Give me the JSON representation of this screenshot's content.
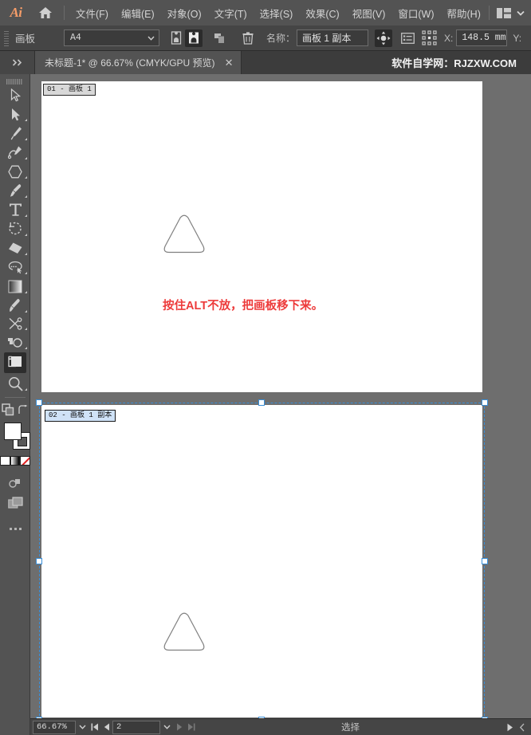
{
  "app": {
    "logo_text": "Ai",
    "home_icon": "home-icon",
    "workspace_icon": "workspace-layout-icon",
    "workspace_chevron": "chevron-down-icon"
  },
  "menubar": {
    "items": [
      {
        "label": "文件(F)",
        "name": "menu-file"
      },
      {
        "label": "编辑(E)",
        "name": "menu-edit"
      },
      {
        "label": "对象(O)",
        "name": "menu-object"
      },
      {
        "label": "文字(T)",
        "name": "menu-type"
      },
      {
        "label": "选择(S)",
        "name": "menu-select"
      },
      {
        "label": "效果(C)",
        "name": "menu-effect"
      },
      {
        "label": "视图(V)",
        "name": "menu-view"
      },
      {
        "label": "窗口(W)",
        "name": "menu-window"
      },
      {
        "label": "帮助(H)",
        "name": "menu-help"
      }
    ]
  },
  "controlbar": {
    "tool_label": "画板",
    "preset_value": "A4",
    "orientation_portrait_icon": "portrait-orientation-icon",
    "orientation_landscape_icon": "landscape-orientation-icon",
    "new_artboard_icon": "new-artboard-icon",
    "delete_icon": "trash-icon",
    "name_label": "名称：",
    "name_value": "画板 1 副本",
    "move_copy_icon": "move-copy-artboard-icon",
    "options_icon": "artboard-options-icon",
    "reference_point_icon": "reference-point-icon",
    "x_label": "X:",
    "x_value": "148.5 mm",
    "y_label": "Y:"
  },
  "tabbar": {
    "expand_icon": "double-chevron-right-icon",
    "doc_title": "未标题-1* @ 66.67% (CMYK/GPU 预览)",
    "close_icon": "close-icon",
    "watermark": "软件自学网：RJZXW.COM"
  },
  "toolbar": {
    "tools": [
      {
        "name": "selection-tool",
        "icon": "arrow-cursor-icon",
        "has_flyout": false,
        "selected": false
      },
      {
        "name": "direct-selection-tool",
        "icon": "solid-arrow-cursor-icon",
        "has_flyout": true,
        "selected": false
      },
      {
        "name": "pen-tool",
        "icon": "pen-nib-icon",
        "has_flyout": true,
        "selected": false
      },
      {
        "name": "curvature-tool",
        "icon": "curvature-pen-icon",
        "has_flyout": true,
        "selected": false
      },
      {
        "name": "shape-tool",
        "icon": "polygon-icon",
        "has_flyout": true,
        "selected": false
      },
      {
        "name": "paintbrush-tool",
        "icon": "paintbrush-icon",
        "has_flyout": true,
        "selected": false
      },
      {
        "name": "type-tool",
        "icon": "type-t-icon",
        "has_flyout": true,
        "selected": false
      },
      {
        "name": "rotate-tool",
        "icon": "rotate-arrow-icon",
        "has_flyout": true,
        "selected": false
      },
      {
        "name": "eraser-tool",
        "icon": "eraser-icon",
        "has_flyout": true,
        "selected": false
      },
      {
        "name": "lasso-tool",
        "icon": "lasso-icon",
        "has_flyout": true,
        "selected": false
      },
      {
        "name": "gradient-tool",
        "icon": "gradient-square-icon",
        "has_flyout": true,
        "selected": false
      },
      {
        "name": "eyedropper-tool",
        "icon": "eyedropper-icon",
        "has_flyout": true,
        "selected": false
      },
      {
        "name": "scissors-tool",
        "icon": "scissors-icon",
        "has_flyout": true,
        "selected": false
      },
      {
        "name": "shape-builder-tool",
        "icon": "shape-builder-icon",
        "has_flyout": true,
        "selected": false
      },
      {
        "name": "artboard-tool",
        "icon": "artboard-icon",
        "has_flyout": false,
        "selected": true
      },
      {
        "name": "zoom-tool",
        "icon": "magnifier-icon",
        "has_flyout": true,
        "selected": false
      }
    ],
    "arrange_icon": "arrange-objects-icon",
    "swap-arrow_icon": "swap-fill-stroke-icon",
    "fill_color": "#ffffff",
    "stroke_color": "#ffffff",
    "color_modes": [
      "solid-color-icon",
      "gradient-icon",
      "none-color-icon"
    ],
    "drawing_mode_icon": "drawing-mode-icon",
    "screen_mode_icon": "screen-mode-icon",
    "more_tools_icon": "edit-toolbar-dots-icon"
  },
  "canvas": {
    "background_color": "#6e6e6e",
    "artboards": [
      {
        "name": "artboard-1",
        "label": "01 - 画板 1",
        "selected": false,
        "shape": "rounded-triangle"
      },
      {
        "name": "artboard-2",
        "label": "02 - 画板 1 副本",
        "selected": true,
        "shape": "rounded-triangle"
      }
    ],
    "annotation": "按住ALT不放，把画板移下来。",
    "annotation_color": "#ed3b3b",
    "selection_color": "#3a8fd8"
  },
  "statusbar": {
    "zoom_value": "66.67%",
    "zoom_chevron": "chevron-down-icon",
    "first_artboard_icon": "first-artboard-icon",
    "prev_artboard_icon": "prev-artboard-icon",
    "artboard_number": "2",
    "artboard_chevron": "chevron-down-icon",
    "next_artboard_icon": "next-artboard-icon",
    "last_artboard_icon": "last-artboard-icon",
    "status_text": "选择",
    "play_icon": "play-triangle-icon",
    "collapse_icon": "chevron-left-icon"
  }
}
